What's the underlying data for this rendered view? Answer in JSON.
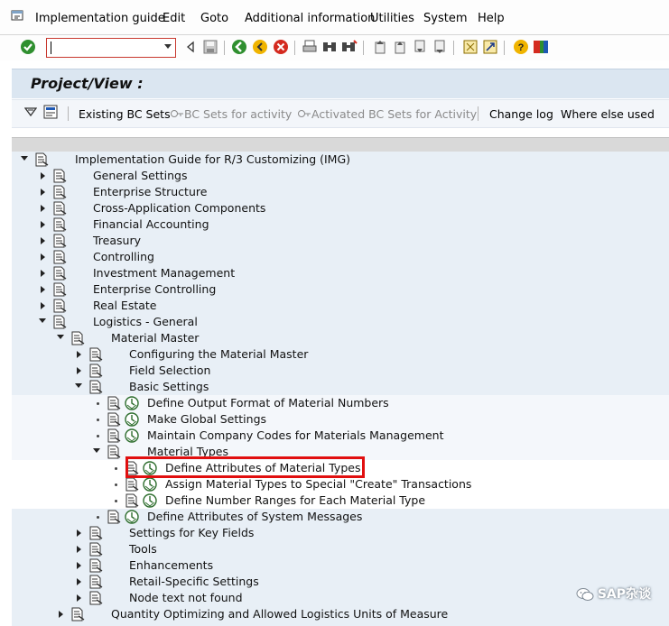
{
  "menubar": {
    "items": [
      "Implementation guide",
      "Edit",
      "Goto",
      "Additional information",
      "Utilities",
      "System",
      "Help"
    ]
  },
  "toolbar": {
    "command_value": "",
    "icons": [
      "enter-icon",
      "back-arrow-icon",
      "save-icon",
      "back-icon",
      "exit-icon",
      "cancel-icon",
      "print-icon",
      "find-icon",
      "find-next-icon",
      "first-page-icon",
      "previous-page-icon",
      "next-page-icon",
      "last-page-icon",
      "create-session-icon",
      "shortcut-icon",
      "help-icon",
      "customize-layout-icon"
    ]
  },
  "title": "Project/View :",
  "appbar": {
    "existing_bc_sets": "Existing BC Sets",
    "bc_sets_for_activity": "BC Sets for activity",
    "activated_bc_sets": "Activated BC Sets for Activity",
    "change_log": "Change log",
    "where_else_used": "Where else used"
  },
  "tree": {
    "root": "Implementation Guide for R/3 Customizing (IMG)",
    "level1": [
      "General Settings",
      "Enterprise Structure",
      "Cross-Application Components",
      "Financial Accounting",
      "Treasury",
      "Controlling",
      "Investment Management",
      "Enterprise Controlling",
      "Real Estate",
      "Logistics - General"
    ],
    "material_master": "Material Master",
    "mm_children": [
      "Configuring the Material Master",
      "Field Selection",
      "Basic Settings"
    ],
    "basic_settings_children": [
      "Define Output Format of Material Numbers",
      "Make Global Settings",
      "Maintain Company Codes for Materials Management",
      "Material Types"
    ],
    "material_types_children": [
      "Define Attributes of Material Types",
      "Assign Material Types to Special \"Create\" Transactions",
      "Define Number Ranges for Each Material Type"
    ],
    "system_messages": "Define Attributes of System Messages",
    "mm_after": [
      "Settings for Key Fields",
      "Tools",
      "Enhancements",
      "Retail-Specific Settings",
      "Node text not found"
    ],
    "last": "Quantity Optimizing and Allowed Logistics Units of Measure"
  },
  "watermark": "SAP杂谈"
}
